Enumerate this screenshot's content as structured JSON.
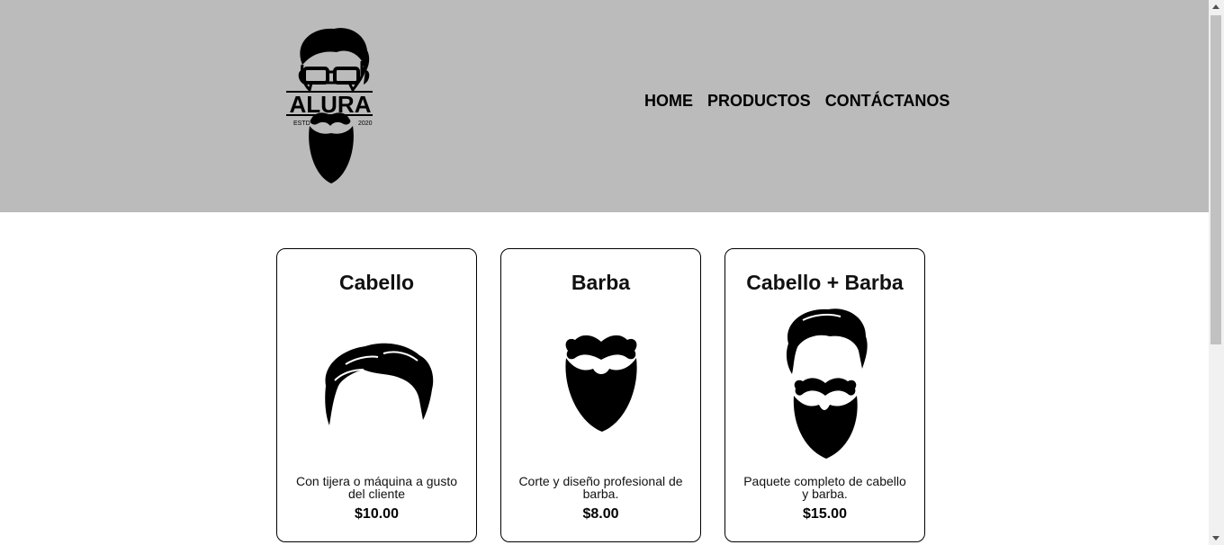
{
  "header": {
    "logo": {
      "brand": "ALURA",
      "left_text": "ESTD",
      "right_text": "2020"
    },
    "nav": [
      {
        "label": "HOME"
      },
      {
        "label": "PRODUCTOS"
      },
      {
        "label": "CONTÁCTANOS"
      }
    ],
    "background": "#bbbbbb"
  },
  "products": [
    {
      "title": "Cabello",
      "image_icon": "hair-icon",
      "description": "Con tijera o máquina a gusto del cliente",
      "price": "$10.00"
    },
    {
      "title": "Barba",
      "image_icon": "beard-icon",
      "description": "Corte y diseño profesional de barba.",
      "price": "$8.00"
    },
    {
      "title": "Cabello + Barba",
      "image_icon": "hair-and-beard-icon",
      "description": "Paquete completo de cabello y barba.",
      "price": "$15.00"
    }
  ]
}
